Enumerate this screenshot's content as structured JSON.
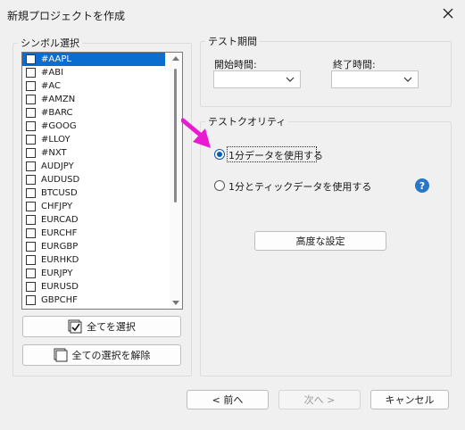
{
  "window": {
    "title": "新規プロジェクトを作成"
  },
  "symbols": {
    "group_label": "シンボル選択",
    "items": [
      "#AAPL",
      "#ABI",
      "#AC",
      "#AMZN",
      "#BARC",
      "#GOOG",
      "#LLOY",
      "#NXT",
      "AUDJPY",
      "AUDUSD",
      "BTCUSD",
      "CHFJPY",
      "EURCAD",
      "EURCHF",
      "EURGBP",
      "EURHKD",
      "EURJPY",
      "EURUSD",
      "GBPCHF"
    ],
    "selected": "#AAPL",
    "select_all_label": "全てを選択",
    "clear_all_label": "全ての選択を解除"
  },
  "test_period": {
    "group_label": "テスト期間",
    "start_label": "開始時間:",
    "end_label": "終了時間:",
    "start_value": "",
    "end_value": ""
  },
  "test_quality": {
    "group_label": "テストクオリティ",
    "options": [
      "1分データを使用する",
      "1分とティックデータを使用する"
    ],
    "selected_index": 0,
    "advanced_label": "高度な設定"
  },
  "footer": {
    "back_label": "< 前へ",
    "next_label": "次へ >",
    "cancel_label": "キャンセル"
  },
  "colors": {
    "selection": "#0a6ed1",
    "annotation_arrow": "#e81bd3",
    "help": "#2a76c7"
  },
  "icons": {
    "close": "close-icon",
    "help": "help-icon",
    "annotation": "arrow-pointer-icon"
  }
}
